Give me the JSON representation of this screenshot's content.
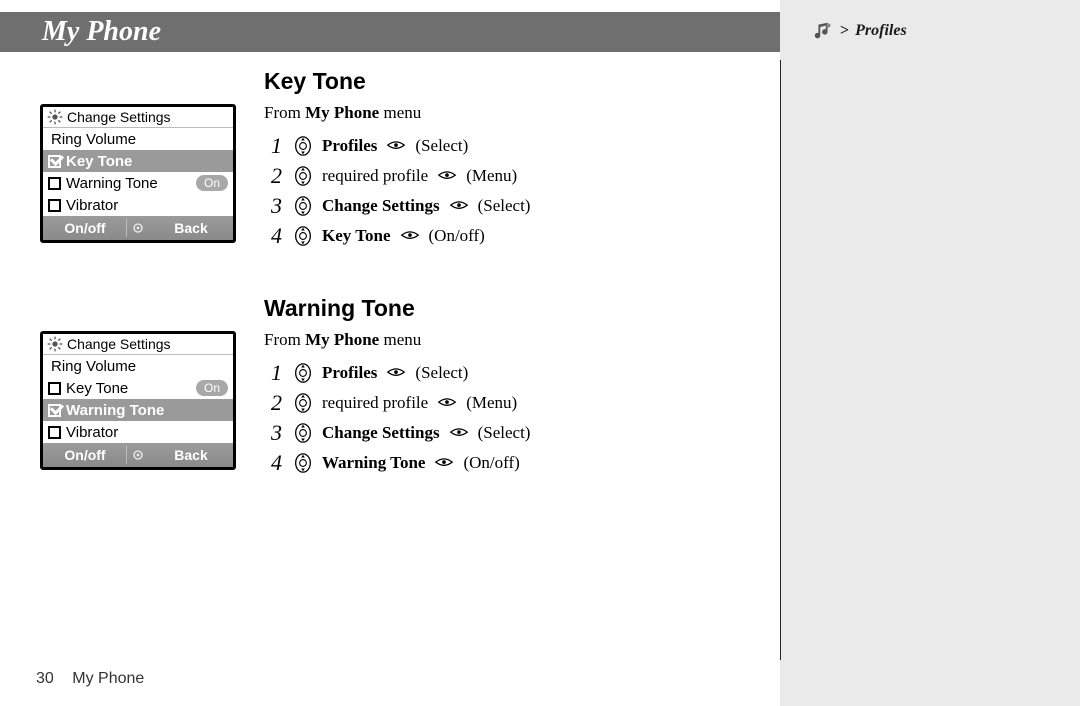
{
  "header": {
    "title": "My Phone"
  },
  "breadcrumb": {
    "label": "Profiles",
    "arrow": ">"
  },
  "footer": {
    "page_number": "30",
    "section": "My Phone"
  },
  "sections": [
    {
      "heading": "Key Tone",
      "from_prefix": "From ",
      "from_bold": "My Phone",
      "from_suffix": " menu",
      "steps": [
        {
          "n": "1",
          "bold": "Profiles",
          "plain": "",
          "action": "(Select)"
        },
        {
          "n": "2",
          "bold": "",
          "plain": "required profile",
          "action": "(Menu)"
        },
        {
          "n": "3",
          "bold": "Change Settings",
          "plain": "",
          "action": "(Select)"
        },
        {
          "n": "4",
          "bold": "Key Tone",
          "plain": "",
          "action": "(On/off)"
        }
      ],
      "screen": {
        "title": "Change Settings",
        "rows": [
          {
            "checkbox": false,
            "checked": false,
            "label": "Ring Volume",
            "pill": "",
            "selected": false
          },
          {
            "checkbox": true,
            "checked": true,
            "label": "Key Tone",
            "pill": "",
            "selected": true
          },
          {
            "checkbox": true,
            "checked": false,
            "label": "Warning Tone",
            "pill": "On",
            "selected": false
          },
          {
            "checkbox": true,
            "checked": false,
            "label": "Vibrator",
            "pill": "",
            "selected": false
          }
        ],
        "softkeys": {
          "left": "On/off",
          "right": "Back"
        }
      }
    },
    {
      "heading": "Warning Tone",
      "from_prefix": "From ",
      "from_bold": "My Phone",
      "from_suffix": " menu",
      "steps": [
        {
          "n": "1",
          "bold": "Profiles",
          "plain": "",
          "action": "(Select)"
        },
        {
          "n": "2",
          "bold": "",
          "plain": "required profile",
          "action": "(Menu)"
        },
        {
          "n": "3",
          "bold": "Change Settings",
          "plain": "",
          "action": "(Select)"
        },
        {
          "n": "4",
          "bold": "Warning Tone",
          "plain": "",
          "action": "(On/off)"
        }
      ],
      "screen": {
        "title": "Change Settings",
        "rows": [
          {
            "checkbox": false,
            "checked": false,
            "label": "Ring Volume",
            "pill": "",
            "selected": false
          },
          {
            "checkbox": true,
            "checked": false,
            "label": "Key Tone",
            "pill": "On",
            "selected": false
          },
          {
            "checkbox": true,
            "checked": true,
            "label": "Warning Tone",
            "pill": "",
            "selected": true
          },
          {
            "checkbox": true,
            "checked": false,
            "label": "Vibrator",
            "pill": "",
            "selected": false
          }
        ],
        "softkeys": {
          "left": "On/off",
          "right": "Back"
        }
      }
    }
  ]
}
